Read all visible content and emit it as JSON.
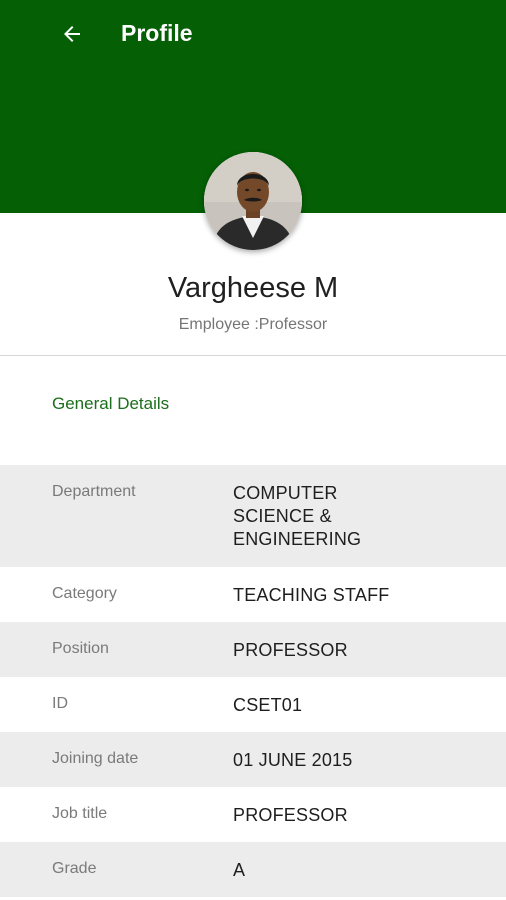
{
  "colors": {
    "appbar": "#055f05",
    "section_title": "#1b6e1b",
    "shaded_row": "#ececec"
  },
  "header": {
    "back_icon": "arrow-left-icon",
    "title": "Profile"
  },
  "profile": {
    "avatar_icon": "profile-photo",
    "name": "Vargheese M",
    "role": "Employee :Professor"
  },
  "section": {
    "title": "General Details"
  },
  "details": [
    {
      "label": "Department",
      "value": "COMPUTER SCIENCE & ENGINEERING"
    },
    {
      "label": "Category",
      "value": "TEACHING STAFF"
    },
    {
      "label": "Position",
      "value": "PROFESSOR"
    },
    {
      "label": "ID",
      "value": "CSET01"
    },
    {
      "label": "Joining date",
      "value": "01 JUNE 2015"
    },
    {
      "label": "Job title",
      "value": "PROFESSOR"
    },
    {
      "label": "Grade",
      "value": "A"
    }
  ]
}
